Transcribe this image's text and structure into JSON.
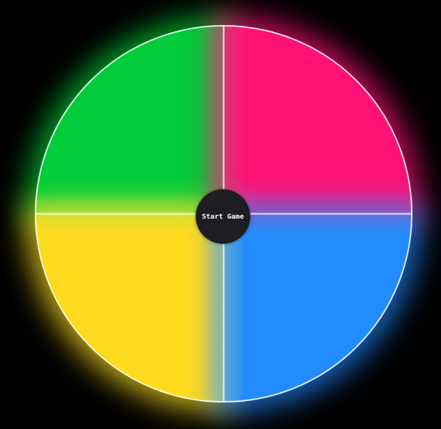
{
  "game": {
    "start_label": "Start Game"
  },
  "pads": {
    "green": "#02cc3a",
    "pink": "#ff1276",
    "yellow": "#ffdb1f",
    "blue": "#228cfc"
  },
  "colors": {
    "background": "#000000",
    "button": "#1d1d22",
    "button_text": "#ffffff"
  }
}
